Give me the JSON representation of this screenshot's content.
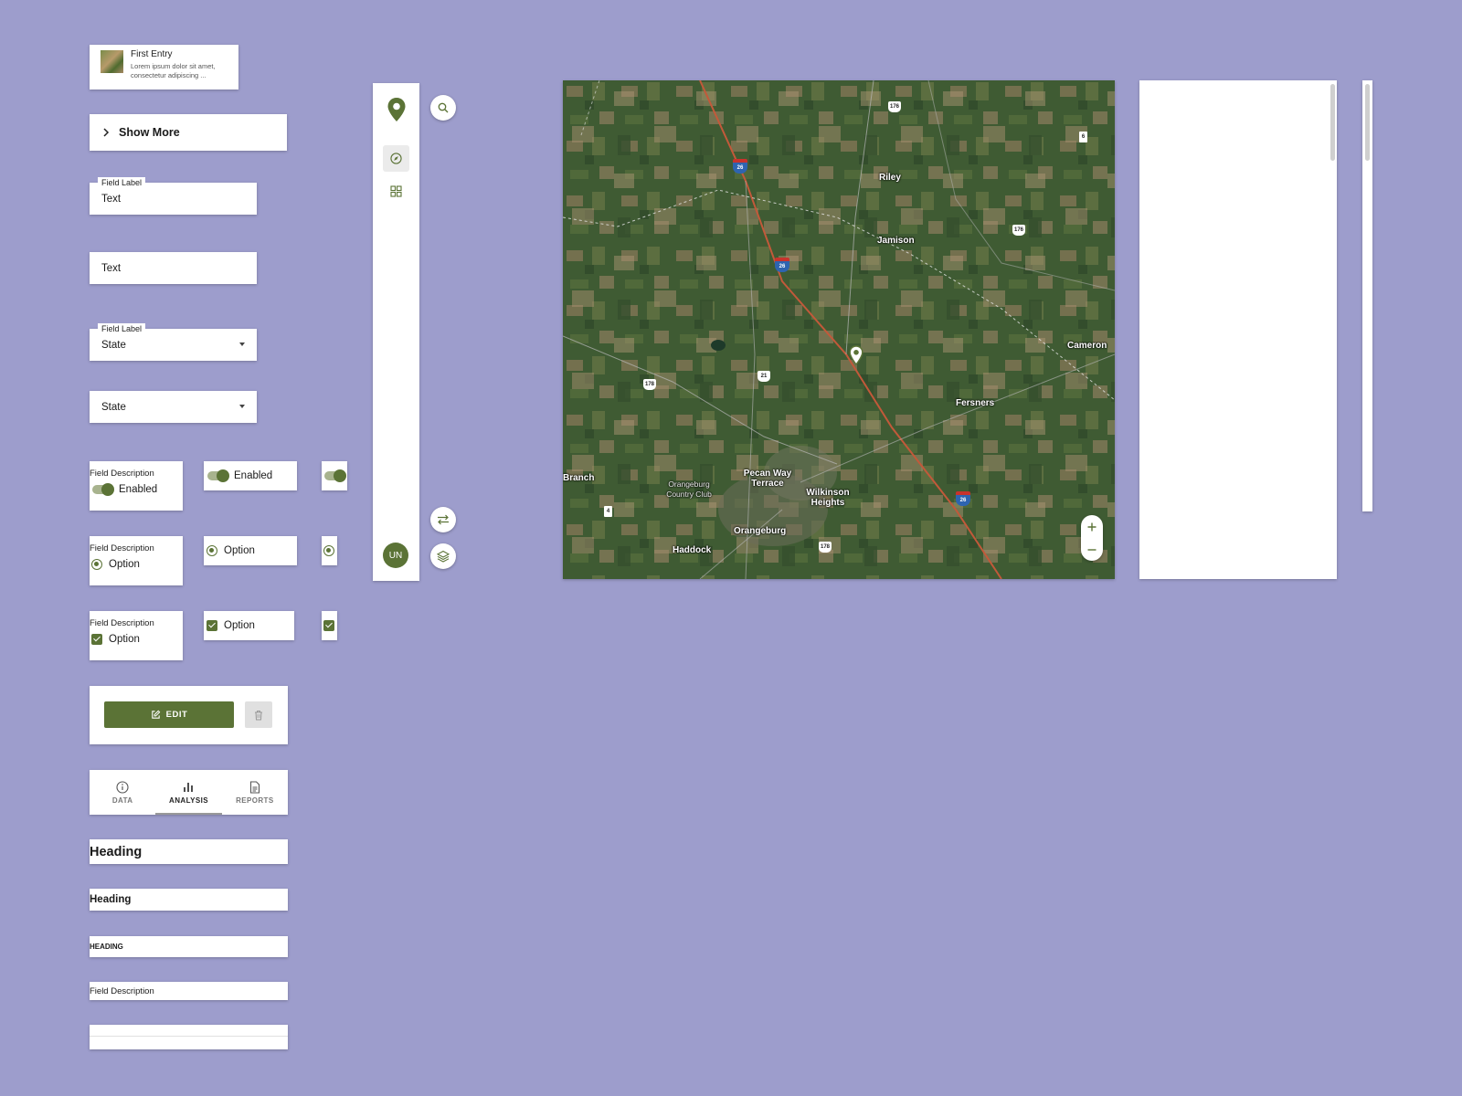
{
  "entry": {
    "title": "First Entry",
    "description": "Lorem ipsum dolor sit amet, consectetur adipiscing ..."
  },
  "show_more": {
    "label": "Show More"
  },
  "fields": {
    "labeled_text": {
      "label": "Field Label",
      "value": "Text"
    },
    "plain_text": {
      "value": "Text"
    },
    "labeled_select": {
      "label": "Field Label",
      "value": "State"
    },
    "plain_select": {
      "value": "State"
    }
  },
  "toggles": {
    "description": "Field Description",
    "label": "Enabled"
  },
  "radios": {
    "description": "Field Description",
    "label": "Option"
  },
  "checkboxes": {
    "description": "Field Description",
    "label": "Option"
  },
  "edit_card": {
    "edit_label": "EDIT"
  },
  "tabs": [
    {
      "label": "DATA",
      "icon": "info-icon"
    },
    {
      "label": "ANALYSIS",
      "icon": "bar-chart-icon",
      "active": true
    },
    {
      "label": "REPORTS",
      "icon": "document-icon"
    }
  ],
  "headings": {
    "h1": "Heading",
    "h2": "Heading",
    "h3": "HEADING",
    "desc": "Field Description"
  },
  "sidebar": {
    "avatar_initials": "UN"
  },
  "map": {
    "places": {
      "riley": "Riley",
      "jamison": "Jamison",
      "cameron": "Cameron",
      "fersners": "Fersners",
      "branch": "Branch",
      "pecan": "Pecan Way Terrace",
      "country_club": "Orangeburg Country Club",
      "wilkinson": "Wilkinson Heights",
      "orangeburg": "Orangeburg",
      "haddock": "Haddock"
    },
    "shields": {
      "us176_top": "176",
      "us176_right": "176",
      "us178": "178",
      "us21": "21",
      "us178_bottom": "178",
      "sr6": "6",
      "sr4": "4",
      "i26_a": "26",
      "i26_b": "26",
      "i26_c": "26"
    }
  },
  "colors": {
    "accent": "#5b7336",
    "background": "#9d9dcc"
  }
}
